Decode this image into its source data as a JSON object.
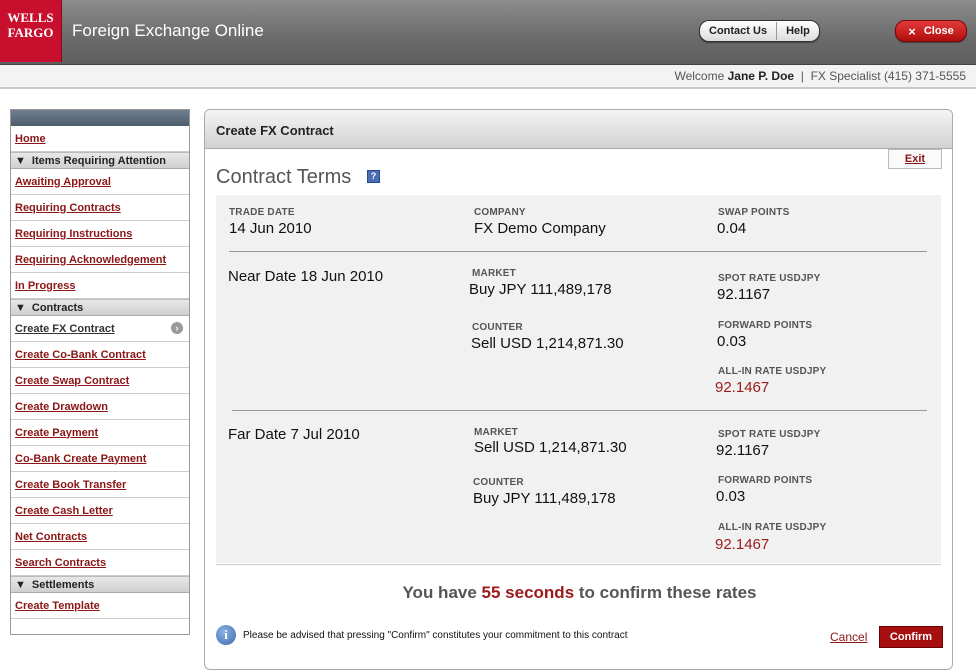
{
  "header": {
    "logo_line1": "WELLS",
    "logo_line2": "FARGO",
    "app_title": "Foreign Exchange Online",
    "contact_label": "Contact Us",
    "help_label": "Help",
    "close_label": "Close",
    "close_glyph": "×"
  },
  "welcome": {
    "prefix": "Welcome",
    "user": "Jane P. Doe",
    "separator": "|",
    "specialist": "FX Specialist (415) 371-5555"
  },
  "sidebar": {
    "items_top": [
      {
        "label": "Home"
      }
    ],
    "section1": "Items Requiring Attention",
    "items1": [
      {
        "label": "Awaiting Approval"
      },
      {
        "label": "Requiring Contracts"
      },
      {
        "label": "Requiring Instructions"
      },
      {
        "label": "Requiring Acknowledgement"
      },
      {
        "label": "In Progress"
      }
    ],
    "section2": "Contracts",
    "items2": [
      {
        "label": "Create FX Contract"
      },
      {
        "label": "Create Co-Bank Contract"
      },
      {
        "label": "Create Swap Contract"
      },
      {
        "label": "Create Drawdown"
      },
      {
        "label": "Create Payment"
      },
      {
        "label": "Co-Bank Create Payment"
      },
      {
        "label": "Create Book Transfer"
      },
      {
        "label": "Create Cash Letter"
      },
      {
        "label": "Net Contracts"
      },
      {
        "label": "Search Contracts"
      }
    ],
    "section3": "Settlements",
    "items3": [
      {
        "label": "Create Template"
      }
    ]
  },
  "panel": {
    "title": "Create FX Contract",
    "exit_label": "Exit",
    "section_title": "Contract Terms",
    "help_glyph": "?"
  },
  "terms": {
    "trade_date_label": "TRADE DATE",
    "trade_date": "14 Jun 2010",
    "company_label": "COMPANY",
    "company": "FX Demo Company",
    "swap_points_label": "SWAP POINTS",
    "swap_points": "0.04",
    "near": {
      "date": "Near Date 18 Jun 2010",
      "market_label": "MARKET",
      "market": "Buy JPY 111,489,178",
      "counter_label": "COUNTER",
      "counter": "Sell USD 1,214,871.30",
      "spot_label": "SPOT RATE USDJPY",
      "spot": "92.1167",
      "fwd_label": "FORWARD POINTS",
      "fwd": "0.03",
      "allin_label": "ALL-IN RATE USDJPY",
      "allin": "92.1467"
    },
    "far": {
      "date": "Far Date 7 Jul 2010",
      "market_label": "MARKET",
      "market": "Sell USD 1,214,871.30",
      "counter_label": "COUNTER",
      "counter": "Buy JPY 111,489,178",
      "spot_label": "SPOT RATE USDJPY",
      "spot": "92.1167",
      "fwd_label": "FORWARD POINTS",
      "fwd": "0.03",
      "allin_label": "ALL-IN RATE USDJPY",
      "allin": "92.1467"
    }
  },
  "timer": {
    "prefix": "You have",
    "seconds": "55 seconds",
    "suffix": "to confirm these rates"
  },
  "footer": {
    "info_glyph": "i",
    "advice": "Please be advised that pressing \"Confirm\" constitutes your commitment to this contract",
    "cancel_label": "Cancel",
    "confirm_label": "Confirm"
  },
  "colors": {
    "brand_red": "#c8102e",
    "accent_red": "#9c1a1a"
  }
}
